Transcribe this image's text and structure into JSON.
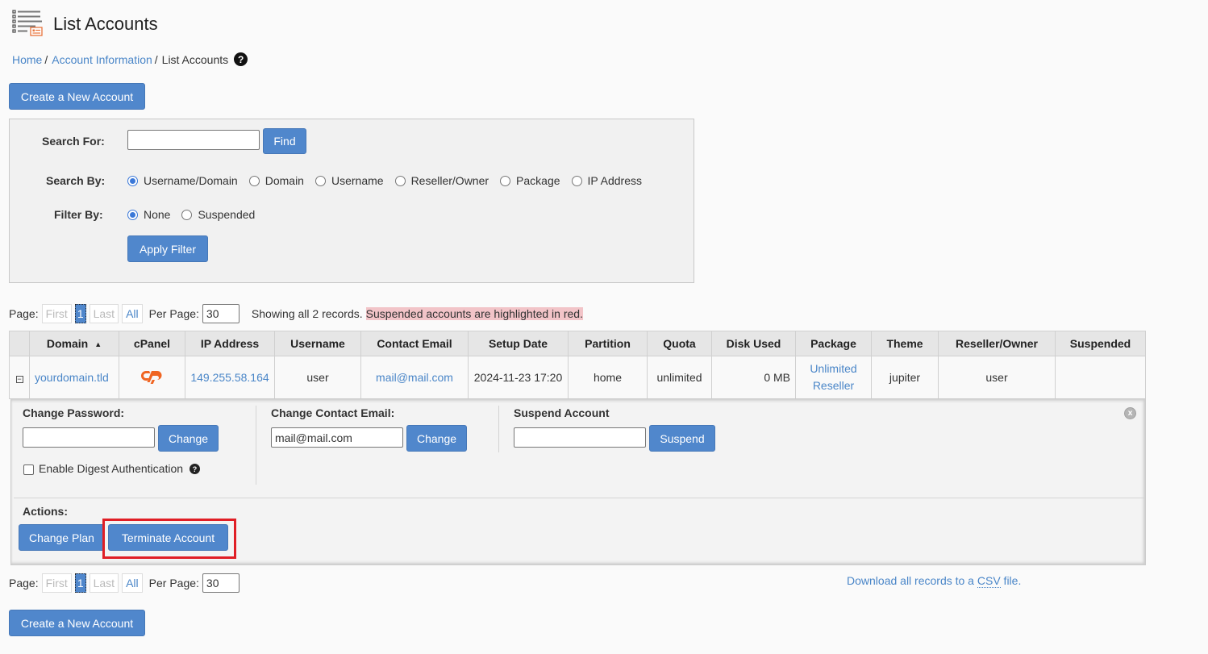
{
  "header": {
    "title": "List Accounts",
    "icon": "list-accounts-icon"
  },
  "breadcrumb": {
    "items": [
      {
        "label": "Home",
        "link": true
      },
      {
        "label": "Account Information",
        "link": true
      },
      {
        "label": "List Accounts",
        "link": false
      }
    ],
    "separator": "/",
    "help_icon": "?"
  },
  "create_button_label": "Create a New Account",
  "search": {
    "search_for_label": "Search For:",
    "search_value": "",
    "find_label": "Find",
    "search_by_label": "Search By:",
    "search_by_options": [
      {
        "label": "Username/Domain",
        "checked": true
      },
      {
        "label": "Domain",
        "checked": false
      },
      {
        "label": "Username",
        "checked": false
      },
      {
        "label": "Reseller/Owner",
        "checked": false
      },
      {
        "label": "Package",
        "checked": false
      },
      {
        "label": "IP Address",
        "checked": false
      }
    ],
    "filter_by_label": "Filter By:",
    "filter_by_options": [
      {
        "label": "None",
        "checked": true
      },
      {
        "label": "Suspended",
        "checked": false
      }
    ],
    "apply_filter_label": "Apply Filter"
  },
  "pager": {
    "page_label": "Page:",
    "first": "First",
    "current": "1",
    "last": "Last",
    "all": "All",
    "per_page_label": "Per Page:",
    "per_page_value": "30",
    "showing_text": "Showing all 2 records.",
    "suspended_note": "Suspended accounts are highlighted in red."
  },
  "table": {
    "columns": [
      "",
      "Domain",
      "cPanel",
      "IP Address",
      "Username",
      "Contact Email",
      "Setup Date",
      "Partition",
      "Quota",
      "Disk Used",
      "Package",
      "Theme",
      "Reseller/Owner",
      "Suspended"
    ],
    "sort_indicator": "▲",
    "rows": [
      {
        "expand": "−",
        "domain": "yourdomain.tld",
        "cpanel": "cP",
        "ip": "149.255.58.164",
        "username": "user",
        "email": "mail@mail.com",
        "setup_date": "2024-11-23 17:20",
        "partition": "home",
        "quota": "unlimited",
        "disk_used": "0 MB",
        "package_line1": "Unlimited",
        "package_line2": "Reseller",
        "theme": "jupiter",
        "owner": "user",
        "suspended": ""
      }
    ]
  },
  "detail": {
    "change_password_label": "Change Password:",
    "password_value": "",
    "change_label": "Change",
    "digest_label": "Enable Digest Authentication",
    "digest_checked": false,
    "change_email_label": "Change Contact Email:",
    "email_value": "mail@mail.com",
    "suspend_label": "Suspend Account",
    "suspend_reason_value": "",
    "suspend_button": "Suspend",
    "actions_label": "Actions:",
    "change_plan": "Change Plan",
    "terminate": "Terminate Account",
    "close_icon": "x"
  },
  "footer": {
    "csv_prefix": "Download all records to a ",
    "csv_abbr": "CSV",
    "csv_suffix": " file."
  },
  "colors": {
    "accent": "#5087cc",
    "link": "#4a86c8",
    "cpanel_orange": "#f06522",
    "highlight_red": "#e01e25",
    "suspended_bg": "#f2c4c8"
  }
}
